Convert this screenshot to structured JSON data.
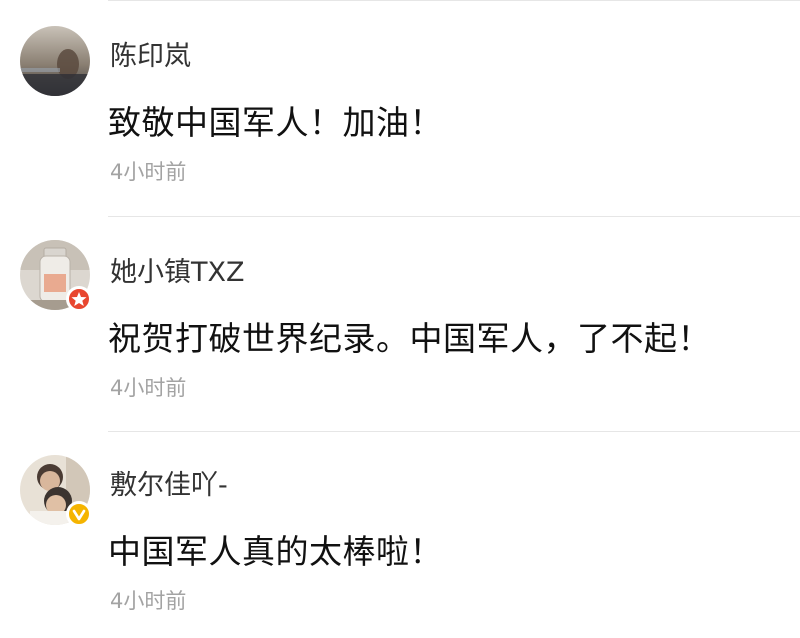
{
  "comments": [
    {
      "username": "陈印岚",
      "content": "致敬中国军人！加油！",
      "time": "4小时前",
      "avatar_icon": "user-photo-avatar",
      "badge": null
    },
    {
      "username": "她小镇TXZ",
      "content": "祝贺打破世界纪录。中国军人，了不起！",
      "time": "4小时前",
      "avatar_icon": "user-photo-avatar",
      "badge": "red-star-badge"
    },
    {
      "username": "敷尔佳吖-",
      "content": "中国军人真的太棒啦！",
      "time": "4小时前",
      "avatar_icon": "user-photo-avatar",
      "badge": "yellow-verified-badge"
    }
  ],
  "colors": {
    "username": "#333333",
    "content": "#111111",
    "time": "#a3a3a3",
    "divider": "#e6e6e6",
    "badge_red": "#e8462f",
    "badge_yellow": "#f5b400"
  }
}
